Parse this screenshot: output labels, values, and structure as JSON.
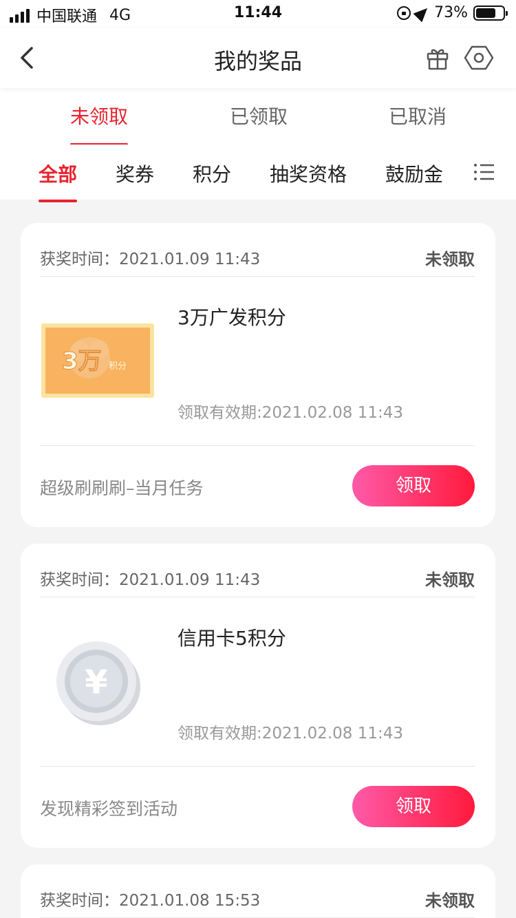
{
  "status_bar": {
    "carrier": "中国联通",
    "network": "4G",
    "time": "11:44",
    "battery_pct": "73%",
    "battery_level": 0.73
  },
  "nav": {
    "title": "我的奖品",
    "icons": [
      "back-chevron-icon",
      "gift-icon",
      "settings-icon"
    ]
  },
  "status_tabs": [
    {
      "label": "未领取",
      "active": true
    },
    {
      "label": "已领取",
      "active": false
    },
    {
      "label": "已取消",
      "active": false
    }
  ],
  "category_tabs": [
    {
      "label": "全部",
      "active": true
    },
    {
      "label": "奖券",
      "active": false
    },
    {
      "label": "积分",
      "active": false
    },
    {
      "label": "抽奖资格",
      "active": false
    },
    {
      "label": "鼓励金",
      "active": false
    }
  ],
  "cards": [
    {
      "win_time": "获奖时间：2021.01.09 11:43",
      "status": "未领取",
      "prize_name": "3万广发积分",
      "prize_image_text": "3万",
      "prize_image_subtext": "积分",
      "expiry": "领取有效期:2021.02.08 11:43",
      "source": "超级刷刷刷–当月任务",
      "button": "领取"
    },
    {
      "win_time": "获奖时间：2021.01.09 11:43",
      "status": "未领取",
      "prize_name": "信用卡5积分",
      "prize_image_text": "¥",
      "expiry": "领取有效期:2021.02.08 11:43",
      "source": "发现精彩签到活动",
      "button": "领取"
    },
    {
      "win_time": "获奖时间：2021.01.08 15:53",
      "status": "未领取"
    }
  ],
  "colors": {
    "accent": "#e8232f",
    "button_gradient_start": "#ff5aa8",
    "button_gradient_end": "#ff1a3c"
  }
}
